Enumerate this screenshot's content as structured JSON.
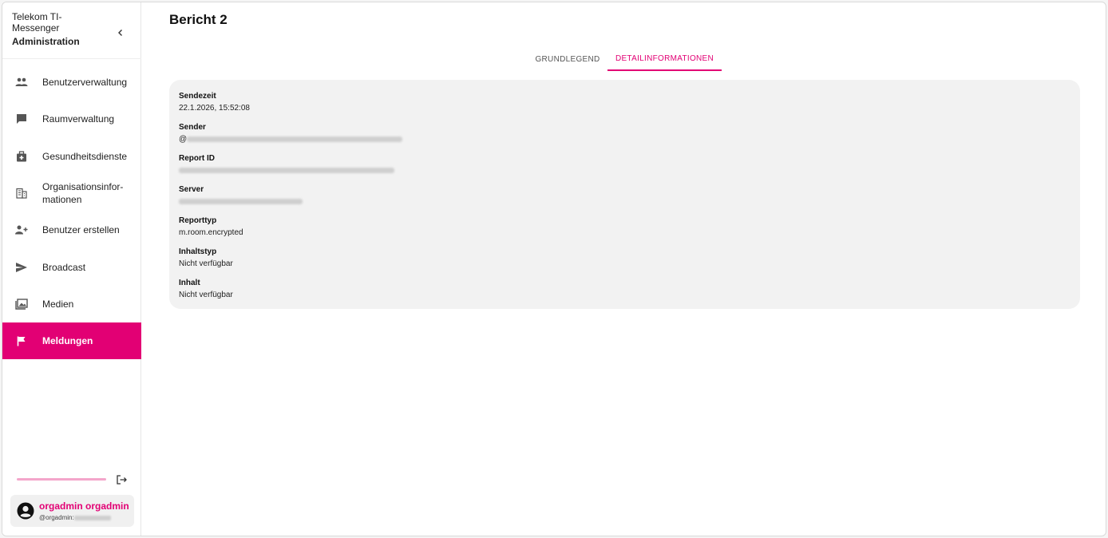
{
  "brand": {
    "line1": "Telekom TI-",
    "line2": "Messenger",
    "line3": "Administration"
  },
  "nav": {
    "items": [
      {
        "label": "Benutzerverwaltung",
        "icon": "people-icon"
      },
      {
        "label": "Raumverwaltung",
        "icon": "chat-icon"
      },
      {
        "label": "Gesundheitsdienste",
        "icon": "medical-bag-icon"
      },
      {
        "label": "Organisationsinfor-\nmationen",
        "icon": "building-icon"
      },
      {
        "label": "Benutzer erstellen",
        "icon": "person-add-icon"
      },
      {
        "label": "Broadcast",
        "icon": "send-icon"
      },
      {
        "label": "Medien",
        "icon": "photo-library-icon"
      },
      {
        "label": "Meldungen",
        "icon": "flag-icon",
        "active": true
      }
    ]
  },
  "user": {
    "name": "orgadmin orgadmin",
    "id_prefix": "@orgadmin:"
  },
  "page": {
    "title": "Bericht 2"
  },
  "tabs": [
    {
      "label": "GRUNDLEGEND",
      "active": false
    },
    {
      "label": "DETAILINFORMATIONEN",
      "active": true
    }
  ],
  "details": [
    {
      "label": "Sendezeit",
      "value": "22.1.2026, 15:52:08"
    },
    {
      "label": "Sender",
      "value": "@"
    },
    {
      "label": "Report ID",
      "value": ""
    },
    {
      "label": "Server",
      "value": ""
    },
    {
      "label": "Reporttyp",
      "value": "m.room.encrypted"
    },
    {
      "label": "Inhaltstyp",
      "value": "Nicht verfügbar"
    },
    {
      "label": "Inhalt",
      "value": "Nicht verfügbar"
    }
  ],
  "colors": {
    "accent": "#e20074",
    "card_bg": "#f2f2f2",
    "progress": "#f4a6cb"
  }
}
